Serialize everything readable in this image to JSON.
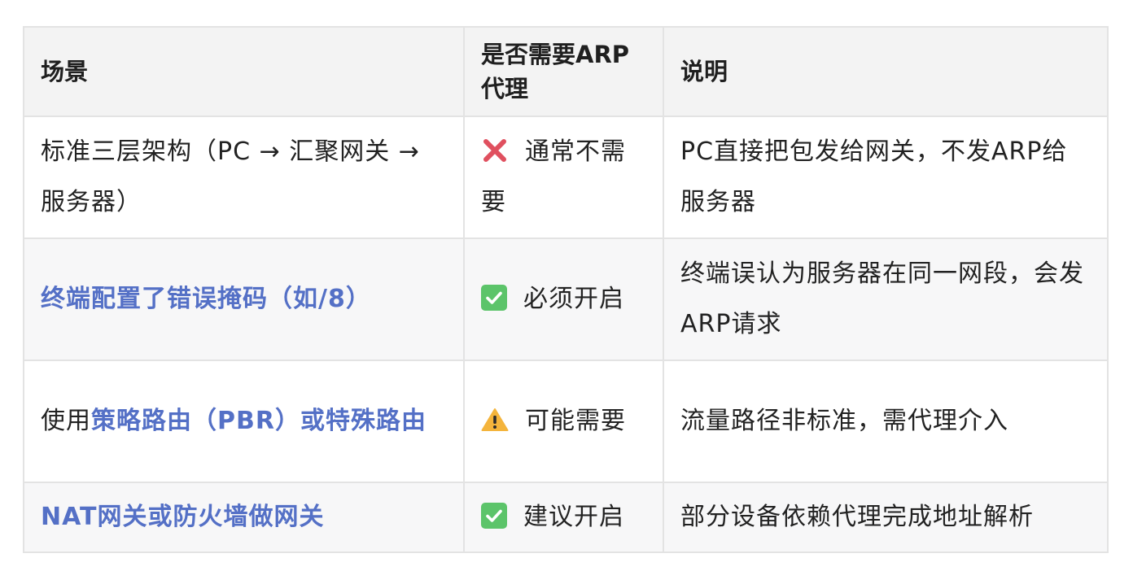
{
  "table": {
    "headers": [
      "场景",
      "是否需要ARP代理",
      "说明"
    ],
    "rows": [
      {
        "scenario": [
          {
            "text": "标准三层架构（PC → 汇聚网关 → 服务器）",
            "highlight": false
          }
        ],
        "status_icon": "red-x-icon",
        "status_text": "通常不需要",
        "note": "PC直接把包发给网关，不发ARP给服务器"
      },
      {
        "scenario": [
          {
            "text": "终端配置了错误掩码（如/8）",
            "highlight": true
          }
        ],
        "status_icon": "green-check-icon",
        "status_text": "必须开启",
        "note": "终端误认为服务器在同一网段，会发ARP请求"
      },
      {
        "scenario": [
          {
            "text": "使用",
            "highlight": false
          },
          {
            "text": "策略路由（PBR）或特殊路由",
            "highlight": true
          }
        ],
        "status_icon": "warning-icon",
        "status_text": "可能需要",
        "note": "流量路径非标准，需代理介入"
      },
      {
        "scenario": [
          {
            "text": "NAT网关或防火墙做网关",
            "highlight": true
          }
        ],
        "status_icon": "green-check-icon",
        "status_text": "建议开启",
        "note": "部分设备依赖代理完成地址解析"
      }
    ]
  },
  "colors": {
    "highlight": "#5470c6",
    "header_bg": "#f3f3f3",
    "stripe_bg": "#f7f7f8",
    "border": "#e3e3e3",
    "x_red": "#e0505f",
    "check_green": "#5cc46a",
    "warning_yellow": "#f4b43c"
  }
}
